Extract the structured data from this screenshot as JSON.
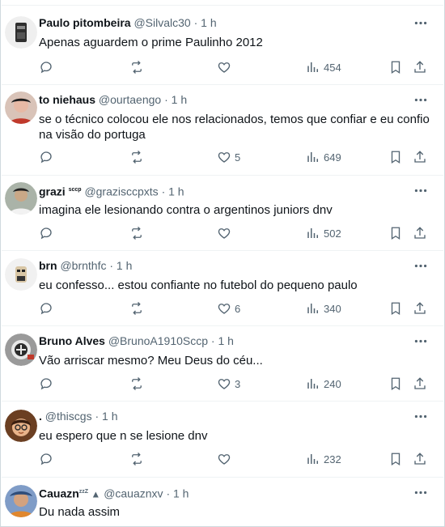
{
  "tweets": [
    {
      "name": "Paulo pitombeira",
      "badge": "",
      "handle": "@Silvalc30",
      "dot": "·",
      "time": "1 h",
      "text": "Apenas aguardem o prime Paulinho 2012",
      "likes": "",
      "views": "454",
      "avatar_color": "#3a3a3a"
    },
    {
      "name": "to niehaus",
      "badge": "",
      "handle": "@ourtaengo",
      "dot": "·",
      "time": "1 h",
      "text": "se o técnico colocou ele nos relacionados, temos que confiar e eu confio na visão do portuga",
      "likes": "5",
      "views": "649",
      "avatar_color": "#c9a089"
    },
    {
      "name": "grazi",
      "badge": "sccp",
      "handle": "@grazisccpxts",
      "dot": "·",
      "time": "1 h",
      "text": "imagina ele lesionando contra o argentinos juniors dnv",
      "likes": "",
      "views": "502",
      "avatar_color": "#6b7a6a"
    },
    {
      "name": "brn",
      "badge": "",
      "handle": "@brnthfc",
      "dot": "·",
      "time": "1 h",
      "text": "eu confesso... estou confiante no futebol do pequeno paulo",
      "likes": "6",
      "views": "340",
      "avatar_color": "#d9d9d9"
    },
    {
      "name": "Bruno Alves",
      "badge": "",
      "handle": "@BrunoA1910Sccp",
      "dot": "·",
      "time": "1 h",
      "text": "Vão arriscar mesmo? Meu Deus do céu...",
      "likes": "3",
      "views": "240",
      "avatar_color": "#8d8d8d"
    },
    {
      "name": ".",
      "badge": "",
      "handle": "@thiscgs",
      "dot": "·",
      "time": "1 h",
      "text": "eu espero que n se lesione dnv",
      "likes": "",
      "views": "232",
      "avatar_color": "#7a4f2e"
    },
    {
      "name": "Cauazn",
      "badge": "zzZ",
      "handle": "@cauaznxv",
      "dot": "·",
      "time": "1 h",
      "text": "Du nada assim",
      "likes": "",
      "views": "",
      "avatar_color": "#5a79a8"
    }
  ],
  "icons": {
    "more": "more-icon",
    "reply": "reply-icon",
    "retweet": "retweet-icon",
    "like": "heart-icon",
    "views": "views-icon",
    "bookmark": "bookmark-icon",
    "share": "share-icon"
  },
  "colors": {
    "text": "#0f1419",
    "secondary": "#536471",
    "divider": "#eff3f4"
  }
}
